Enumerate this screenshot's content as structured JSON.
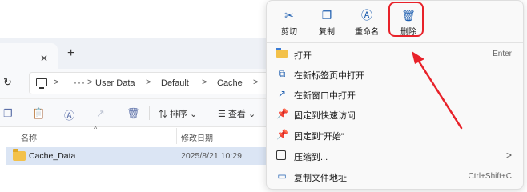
{
  "explorer": {
    "tabs": {
      "close_glyph": "✕",
      "new_tab_glyph": "+"
    },
    "address": {
      "ellipsis": "···",
      "breadcrumbs": [
        "User Data",
        "Default",
        "Cache"
      ],
      "separator": ">"
    },
    "toolbar": {
      "sort_label": "⇅ 排序 ⌄",
      "view_label": "☰ 查看 ⌄"
    },
    "filelist": {
      "columns": [
        "名称",
        "修改日期"
      ],
      "rows": [
        {
          "name": "Cache_Data",
          "date": "2025/8/21 10:29"
        }
      ]
    }
  },
  "context_menu": {
    "quick_actions": [
      {
        "label": "剪切",
        "icon": "cut-icon",
        "glyph": "✂"
      },
      {
        "label": "复制",
        "icon": "copy-icon",
        "glyph": "❐"
      },
      {
        "label": "重命名",
        "icon": "rename-icon",
        "glyph": "Ⓐ"
      },
      {
        "label": "删除",
        "icon": "delete-icon",
        "glyph": "🗑"
      }
    ],
    "items": [
      {
        "label": "打开",
        "shortcut": "Enter",
        "icon": "folder-icon"
      },
      {
        "label": "在新标签页中打开",
        "shortcut": "",
        "icon": "new-tab-icon"
      },
      {
        "label": "在新窗口中打开",
        "shortcut": "",
        "icon": "new-window-icon"
      },
      {
        "label": "固定到快速访问",
        "shortcut": "",
        "icon": "pin-icon"
      },
      {
        "label": "固定到\"开始\"",
        "shortcut": "",
        "icon": "pin-start-icon"
      },
      {
        "label": "压缩到...",
        "shortcut": "",
        "icon": "compress-icon",
        "submenu": ">"
      },
      {
        "label": "复制文件地址",
        "shortcut": "Ctrl+Shift+C",
        "icon": "copy-path-icon"
      }
    ]
  },
  "colors": {
    "highlight": "#e8222a",
    "accent": "#1f5fb0",
    "selection": "#dbe5f4"
  }
}
